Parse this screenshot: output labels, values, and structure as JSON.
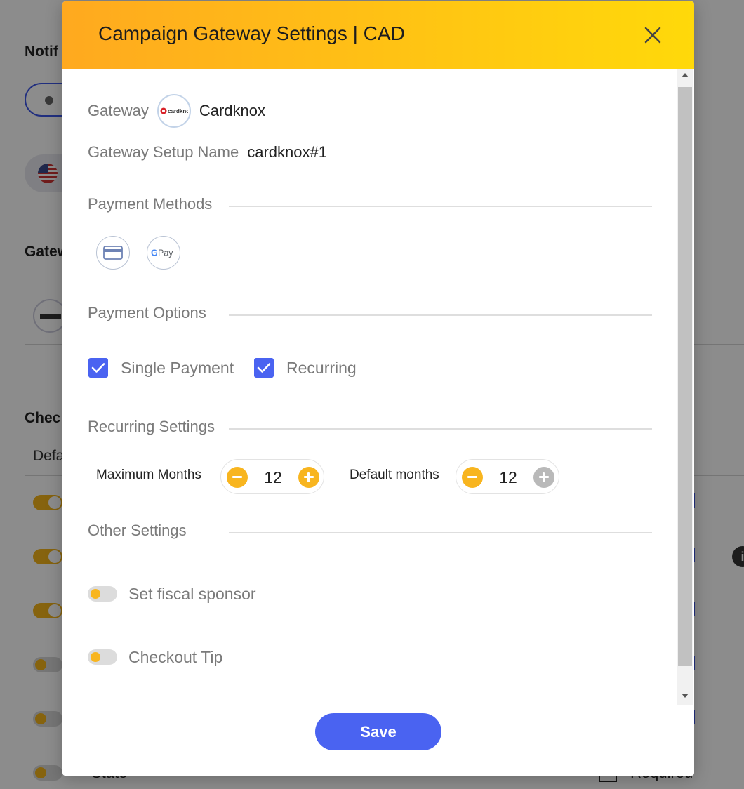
{
  "background": {
    "heading_notif": "Notif",
    "heading_gatew": "Gatew",
    "heading_chec": "Chec",
    "text_defa": "Defa",
    "row_state": "State",
    "required_label": "Required"
  },
  "modal": {
    "title": "Campaign Gateway Settings | CAD",
    "gateway_label": "Gateway",
    "gateway_name": "Cardknox",
    "gateway_logo_text": "cardknox",
    "setup_name_label": "Gateway Setup Name",
    "setup_name_value": "cardknox#1",
    "payment_methods": {
      "title": "Payment Methods",
      "items": [
        {
          "name": "card",
          "icon": "credit-card-icon"
        },
        {
          "name": "G Pay",
          "icon": "google-pay-icon"
        }
      ]
    },
    "payment_options": {
      "title": "Payment Options",
      "options": [
        {
          "label": "Single Payment",
          "checked": true
        },
        {
          "label": "Recurring",
          "checked": true
        }
      ]
    },
    "recurring_settings": {
      "title": "Recurring Settings",
      "maximum_months_label": "Maximum Months",
      "maximum_months_value": "12",
      "default_months_label": "Default months",
      "default_months_value": "12"
    },
    "other_settings": {
      "title": "Other Settings",
      "toggles": [
        {
          "label": "Set fiscal sponsor",
          "on": false
        },
        {
          "label": "Checkout Tip",
          "on": false
        }
      ]
    },
    "save_label": "Save"
  },
  "colors": {
    "header_gradient_start": "#ffa91f",
    "header_gradient_end": "#ffd90a",
    "primary": "#4a63f1",
    "accent": "#f8b51f"
  }
}
